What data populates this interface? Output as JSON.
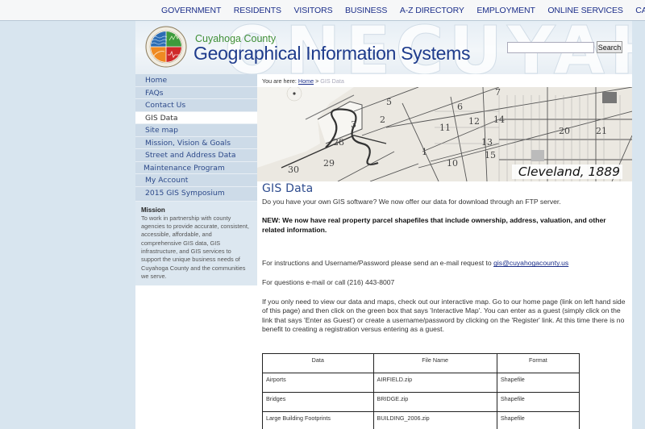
{
  "topnav": {
    "items": [
      "GOVERNMENT",
      "RESIDENTS",
      "VISITORS",
      "BUSINESS",
      "A-Z DIRECTORY",
      "EMPLOYMENT",
      "ONLINE SERVICES",
      "CALENDAR"
    ]
  },
  "header": {
    "logo_icon": "county-seal-icon",
    "county": "Cuyahoga County",
    "title": "Geographical Information Systems",
    "banner_ghost": "ONECUYAHOGA",
    "search": {
      "value": "",
      "placeholder": "",
      "button_label": "Search"
    }
  },
  "sidebar": {
    "items": [
      {
        "label": "Home",
        "active": false
      },
      {
        "label": "FAQs",
        "active": false
      },
      {
        "label": "Contact Us",
        "active": false
      },
      {
        "label": "GIS Data",
        "active": true
      },
      {
        "label": "Site map",
        "active": false
      },
      {
        "label": "Mission, Vision & Goals",
        "active": false
      },
      {
        "label": "Street and Address Data",
        "active": false
      },
      {
        "label": "Maintenance Program",
        "active": false
      },
      {
        "label": "My Account",
        "active": false
      },
      {
        "label": "2015 GIS Symposium",
        "active": false
      }
    ],
    "mission": {
      "heading": "Mission",
      "text": "To work in partnership with county agencies to provide accurate, consistent, accessible, affordable, and comprehensive GIS data, GIS infrastructure, and GIS services to support the unique business needs of Cuyahoga County and the communities we serve."
    }
  },
  "breadcrumb": {
    "prefix": "You are here:",
    "home": "Home",
    "separator": ">",
    "current": "GIS Data"
  },
  "hero": {
    "caption": "Cleveland, 1889",
    "ward_numbers": [
      "3",
      "2",
      "5",
      "6",
      "7",
      "12",
      "14",
      "20",
      "21",
      "13",
      "15",
      "1",
      "28",
      "29",
      "30",
      "10",
      "11"
    ]
  },
  "main": {
    "title": "GIS Data",
    "intro": "Do you have your own GIS software? We now offer our data for download through an FTP server.",
    "new_notice": "NEW: We now have real property parcel shapefiles that include ownership, address, valuation, and other related information.",
    "instructions_prefix": "For instructions and Username/Password please send an e-mail request to ",
    "email": "gis@cuyahogacounty.us",
    "questions": "For questions e-mail or call (216) 443-8007",
    "interactive_map": "If you only need to view our data and maps, check out our interactive map. Go to our home page (link on left hand side of this page) and then click on the green box that says 'Interactive Map'. You can enter as a guest (simply click on the link that says 'Enter as Guest') or create a username/password by clicking on the 'Register' link. At this time there is no benefit to creating a registration versus entering as a guest."
  },
  "table": {
    "headers": [
      "Data",
      "File Name",
      "Format"
    ],
    "rows": [
      [
        "Airports",
        "AIRFIELD.zip",
        "Shapefile"
      ],
      [
        "Bridges",
        "BRIDGE.zip",
        "Shapefile"
      ],
      [
        "Large Building Footprints",
        "BUILDING_2006.zip",
        "Shapefile"
      ]
    ]
  },
  "colors": {
    "nav_link": "#1c2f8a",
    "title_blue": "#1e3b8c",
    "county_green": "#3f8f36",
    "sidebar_bg": "#cddbe8",
    "page_bg": "#d8e5ef"
  }
}
